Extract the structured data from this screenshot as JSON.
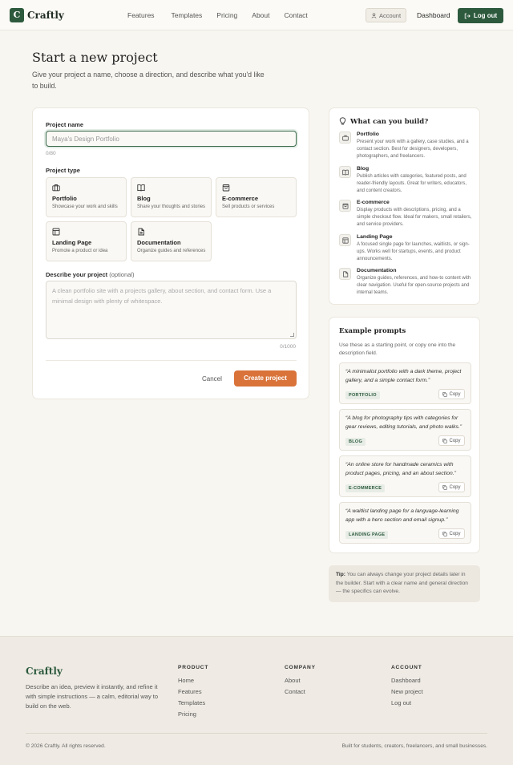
{
  "header": {
    "logo_letter": "C",
    "brand": "Craftly",
    "nav": [
      "Features",
      "Templates",
      "Pricing",
      "About",
      "Contact"
    ],
    "account_label": "Account",
    "dashboard_label": "Dashboard",
    "logout_label": "Log out"
  },
  "hero": {
    "title": "Start a new project",
    "subtitle": "Give your project a name, choose a direction, and describe what you'd like to build."
  },
  "form": {
    "name_label": "Project name",
    "name_placeholder": "Maya's Design Portfolio",
    "name_counter": "0/80",
    "type_label": "Project type",
    "types": [
      {
        "name": "Portfolio",
        "desc": "Showcase your work and skills",
        "icon": "briefcase-icon"
      },
      {
        "name": "Blog",
        "desc": "Share your thoughts and stories",
        "icon": "book-icon"
      },
      {
        "name": "E-commerce",
        "desc": "Sell products or services",
        "icon": "shopping-bag-icon"
      },
      {
        "name": "Landing Page",
        "desc": "Promote a product or idea",
        "icon": "layout-icon"
      },
      {
        "name": "Documentation",
        "desc": "Organize guides and references",
        "icon": "document-icon"
      }
    ],
    "desc_label": "Describe your project",
    "desc_optional": "(optional)",
    "desc_placeholder": "A clean portfolio site with a projects gallery, about section, and contact form. Use a minimal design with plenty of whitespace.",
    "desc_counter": "0/1000",
    "cancel_label": "Cancel",
    "create_label": "Create project"
  },
  "build": {
    "title": "What can you build?",
    "items": [
      {
        "name": "Portfolio",
        "desc": "Present your work with a gallery, case studies, and a contact section. Best for designers, developers, photographers, and freelancers."
      },
      {
        "name": "Blog",
        "desc": "Publish articles with categories, featured posts, and reader-friendly layouts. Great for writers, educators, and content creators."
      },
      {
        "name": "E-commerce",
        "desc": "Display products with descriptions, pricing, and a simple checkout flow. Ideal for makers, small retailers, and service providers."
      },
      {
        "name": "Landing Page",
        "desc": "A focused single page for launches, waitlists, or sign-ups. Works well for startups, events, and product announcements."
      },
      {
        "name": "Documentation",
        "desc": "Organize guides, references, and how-to content with clear navigation. Useful for open-source projects and internal teams."
      }
    ]
  },
  "prompts": {
    "title": "Example prompts",
    "subtitle": "Use these as a starting point, or copy one into the description field.",
    "copy_label": "Copy",
    "items": [
      {
        "text": "“A minimalist portfolio with a dark theme, project gallery, and a simple contact form.”",
        "tag": "PORTFOLIO"
      },
      {
        "text": "“A blog for photography tips with categories for gear reviews, editing tutorials, and photo walks.”",
        "tag": "BLOG"
      },
      {
        "text": "“An online store for handmade ceramics with product pages, pricing, and an about section.”",
        "tag": "E-COMMERCE"
      },
      {
        "text": "“A waitlist landing page for a language-learning app with a hero section and email signup.”",
        "tag": "LANDING PAGE"
      }
    ]
  },
  "tip": {
    "label": "Tip:",
    "text": "You can always change your project details later in the builder. Start with a clear name and general direction — the specifics can evolve."
  },
  "footer": {
    "brand": "Craftly",
    "desc": "Describe an idea, preview it instantly, and refine it with simple instructions — a calm, editorial way to build on the web.",
    "columns": [
      {
        "heading": "PRODUCT",
        "links": [
          "Home",
          "Features",
          "Templates",
          "Pricing"
        ]
      },
      {
        "heading": "COMPANY",
        "links": [
          "About",
          "Contact"
        ]
      },
      {
        "heading": "ACCOUNT",
        "links": [
          "Dashboard",
          "New project",
          "Log out"
        ]
      }
    ],
    "copyright": "© 2026 Craftly. All rights reserved.",
    "built_for": "Built for students, creators, freelancers, and small businesses."
  },
  "colors": {
    "brand_green": "#2d5a3d",
    "accent_orange": "#d9733a",
    "background": "#f8f6f1"
  }
}
